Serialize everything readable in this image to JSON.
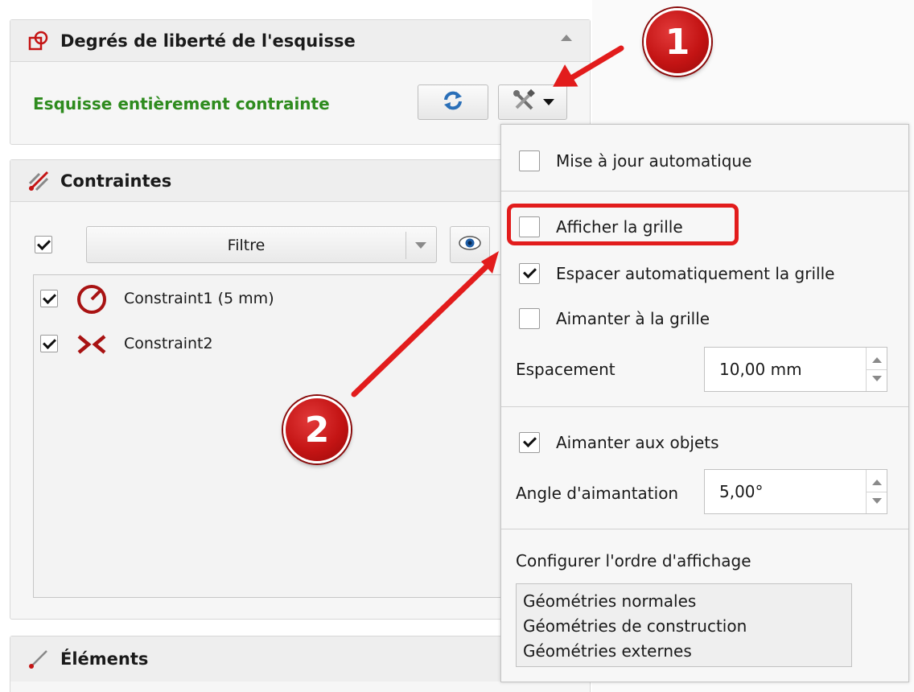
{
  "dof_panel": {
    "title": "Degrés de liberté de l'esquisse",
    "status": "Esquisse entièrement contrainte"
  },
  "constraints_panel": {
    "title": "Contraintes",
    "filter_label": "Filtre",
    "items": [
      {
        "label": "Constraint1 (5 mm)",
        "checked": true,
        "icon": "radius-constraint-icon"
      },
      {
        "label": "Constraint2",
        "checked": true,
        "icon": "coincident-constraint-icon"
      }
    ]
  },
  "elements_panel": {
    "title": "Éléments"
  },
  "settings_menu": {
    "auto_update": {
      "label": "Mise à jour automatique",
      "checked": false
    },
    "show_grid": {
      "label": "Afficher la grille",
      "checked": false
    },
    "auto_grid_spacing": {
      "label": "Espacer automatiquement la grille",
      "checked": true
    },
    "snap_grid": {
      "label": "Aimanter à la grille",
      "checked": false
    },
    "spacing": {
      "label": "Espacement",
      "value": "10,00 mm"
    },
    "snap_objects": {
      "label": "Aimanter aux objets",
      "checked": true
    },
    "snap_angle": {
      "label": "Angle d'aimantation",
      "value": "5,00°"
    },
    "display_order": {
      "label": "Configurer l'ordre d'affichage",
      "items": [
        "Géométries normales",
        "Géométries de construction",
        "Géométries externes"
      ]
    }
  },
  "annotations": {
    "badge_1": "1",
    "badge_2": "2"
  },
  "colors": {
    "status_green": "#2e8b1e",
    "annotation_red": "#e21c1c"
  }
}
